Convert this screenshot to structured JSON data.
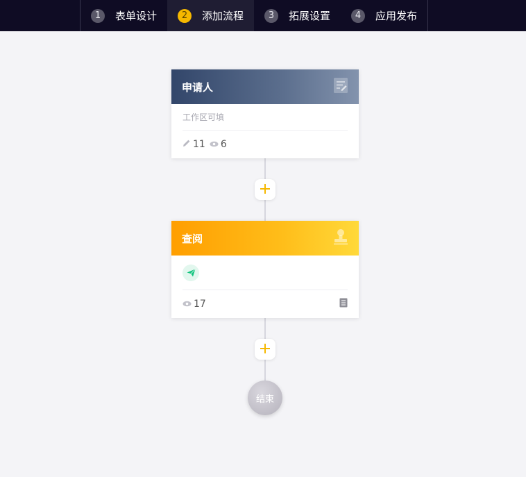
{
  "topbar": {
    "steps": [
      {
        "num": "1",
        "label": "表单设计"
      },
      {
        "num": "2",
        "label": "添加流程"
      },
      {
        "num": "3",
        "label": "拓展设置"
      },
      {
        "num": "4",
        "label": "应用发布"
      }
    ],
    "active_step": 2,
    "accent_color": "#f6b800"
  },
  "flow": {
    "nodes": [
      {
        "title": "申请人",
        "icon": "form-edit-icon",
        "desc": "工作区可填",
        "edit_count": "11",
        "view_count": "6",
        "color": "#32466a"
      },
      {
        "title": "查阅",
        "icon": "stamp-icon",
        "action_icon": "send-icon",
        "view_count": "17",
        "foot_icon": "document-icon",
        "color": "#ffb300"
      }
    ],
    "add_button_icon": "plus-icon",
    "end_label": "结束"
  }
}
